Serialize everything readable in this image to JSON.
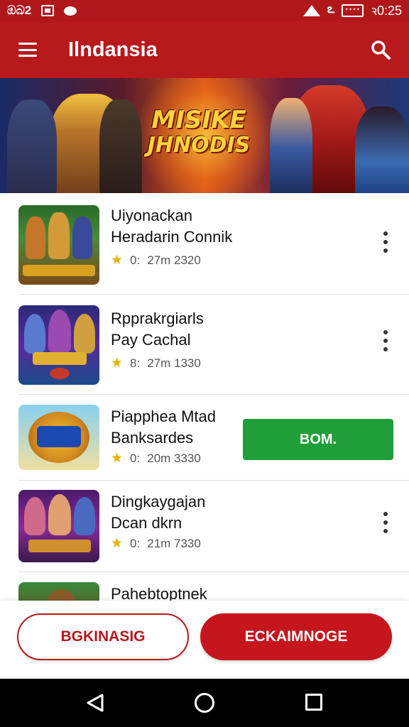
{
  "status_bar": {
    "left_text": "ඔබ2",
    "right_icon_text": "ఽ",
    "battery": "ᐩᐩᐩᐩ",
    "time": "ꝛ0:25"
  },
  "app_bar": {
    "title": "Ilndansia",
    "menu_icon": "hamburger-menu-icon",
    "search_icon": "search-icon",
    "color": "#b8191d"
  },
  "banner": {
    "title_line1": "MISIKE",
    "title_line2": "JHNODIS"
  },
  "list": {
    "items": [
      {
        "line1": "Uiyonackan",
        "line2": "Heradarin Connik",
        "rating_prefix": "0:",
        "meta": "27m 2320",
        "action": "more"
      },
      {
        "line1": "Rpprakrgiarls",
        "line2": "Pay Cachal",
        "rating_prefix": "8:",
        "meta": "27m 1330",
        "action": "more"
      },
      {
        "line1": "Piapphea Mtad",
        "line2": "Banksardes",
        "rating_prefix": "0:",
        "meta": "20m 3330",
        "action": "install"
      },
      {
        "line1": "Dingkaygajan",
        "line2": "Dcan dkrn",
        "rating_prefix": "0:",
        "meta": "21m 7330",
        "action": "more"
      },
      {
        "line1": "Pahebtoptnek",
        "line2": "",
        "rating_prefix": "",
        "meta": "",
        "action": "none"
      }
    ],
    "install_label": "BOM."
  },
  "bottom_actions": {
    "secondary_label": "BGKINASIG",
    "primary_label": "ECKAIMNOGE"
  },
  "colors": {
    "brand_red": "#b8191d",
    "install_green": "#1f9e3a",
    "star_yellow": "#e8b400"
  }
}
